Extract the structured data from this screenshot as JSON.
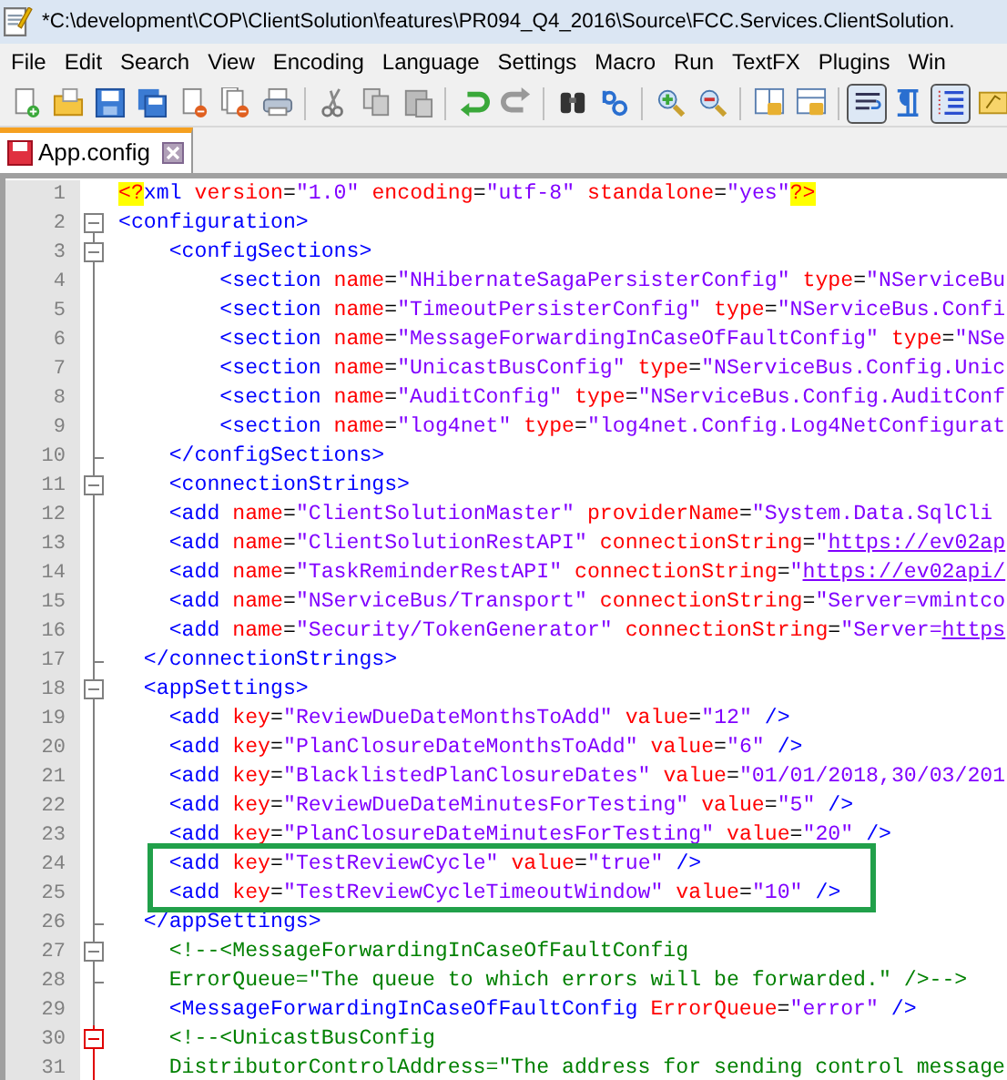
{
  "window": {
    "title": "*C:\\development\\COP\\ClientSolution\\features\\PR094_Q4_2016\\Source\\FCC.Services.ClientSolution."
  },
  "menu": [
    "File",
    "Edit",
    "Search",
    "View",
    "Encoding",
    "Language",
    "Settings",
    "Macro",
    "Run",
    "TextFX",
    "Plugins",
    "Win"
  ],
  "toolbar": [
    {
      "kind": "new",
      "pressed": false
    },
    {
      "kind": "open",
      "pressed": false
    },
    {
      "kind": "save",
      "pressed": false
    },
    {
      "kind": "save-all",
      "pressed": false
    },
    {
      "kind": "close",
      "pressed": false
    },
    {
      "kind": "close-all",
      "pressed": false
    },
    {
      "kind": "print",
      "pressed": false
    },
    {
      "kind": "sep"
    },
    {
      "kind": "cut",
      "pressed": false
    },
    {
      "kind": "copy",
      "pressed": false
    },
    {
      "kind": "paste",
      "pressed": false
    },
    {
      "kind": "sep"
    },
    {
      "kind": "undo",
      "pressed": false
    },
    {
      "kind": "redo",
      "pressed": false
    },
    {
      "kind": "sep"
    },
    {
      "kind": "find",
      "pressed": false
    },
    {
      "kind": "replace",
      "pressed": false
    },
    {
      "kind": "sep"
    },
    {
      "kind": "zoom-in",
      "pressed": false
    },
    {
      "kind": "zoom-out",
      "pressed": false
    },
    {
      "kind": "sep"
    },
    {
      "kind": "sync-v",
      "pressed": false
    },
    {
      "kind": "sync-h",
      "pressed": false
    },
    {
      "kind": "sep"
    },
    {
      "kind": "wrap",
      "pressed": true
    },
    {
      "kind": "all-chars",
      "pressed": false
    },
    {
      "kind": "indent-guide",
      "pressed": true
    },
    {
      "kind": "macro",
      "pressed": false
    }
  ],
  "tabs": [
    {
      "label": "App.config",
      "selected": true,
      "modified": true
    }
  ],
  "editor": {
    "lines": [
      {
        "number": "1",
        "collapsible": false,
        "block_end": false,
        "boxed": false,
        "tokens": [
          {
            "kind": "pi",
            "text": "<?"
          },
          {
            "kind": "tag",
            "text": "xml"
          },
          {
            "kind": "attr",
            "text": " version"
          },
          {
            "kind": "plain",
            "text": "="
          },
          {
            "kind": "value",
            "text": "\"1.0\""
          },
          {
            "kind": "attr",
            "text": " encoding"
          },
          {
            "kind": "plain",
            "text": "="
          },
          {
            "kind": "value",
            "text": "\"utf-8\""
          },
          {
            "kind": "attr",
            "text": " standalone"
          },
          {
            "kind": "plain",
            "text": "="
          },
          {
            "kind": "value",
            "text": "\"yes\""
          },
          {
            "kind": "pi",
            "text": "?>"
          }
        ]
      },
      {
        "number": "2",
        "collapsible": true,
        "block_end": false,
        "highlighted": false,
        "boxed": false,
        "tokens": [
          {
            "kind": "tag",
            "text": "<configuration>"
          }
        ]
      },
      {
        "number": "3",
        "collapsible": true,
        "block_end": false,
        "highlighted": false,
        "boxed": false,
        "tokens": [
          {
            "kind": "tag",
            "text": "    <configSections>"
          }
        ]
      },
      {
        "number": "4",
        "collapsible": false,
        "block_end": false,
        "highlighted": false,
        "boxed": false,
        "tokens": [
          {
            "kind": "tag",
            "text": "        <section"
          },
          {
            "kind": "attr",
            "text": " name"
          },
          {
            "kind": "plain",
            "text": "="
          },
          {
            "kind": "value",
            "text": "\"NHibernateSagaPersisterConfig\""
          },
          {
            "kind": "attr",
            "text": " type"
          },
          {
            "kind": "plain",
            "text": "="
          },
          {
            "kind": "value",
            "text": "\"NServiceBu"
          }
        ]
      },
      {
        "number": "5",
        "collapsible": false,
        "block_end": false,
        "highlighted": false,
        "boxed": false,
        "tokens": [
          {
            "kind": "tag",
            "text": "        <section"
          },
          {
            "kind": "attr",
            "text": " name"
          },
          {
            "kind": "plain",
            "text": "="
          },
          {
            "kind": "value",
            "text": "\"TimeoutPersisterConfig\""
          },
          {
            "kind": "attr",
            "text": " type"
          },
          {
            "kind": "plain",
            "text": "="
          },
          {
            "kind": "value",
            "text": "\"NServiceBus.Confi"
          }
        ]
      },
      {
        "number": "6",
        "collapsible": false,
        "block_end": false,
        "highlighted": false,
        "boxed": false,
        "tokens": [
          {
            "kind": "tag",
            "text": "        <section"
          },
          {
            "kind": "attr",
            "text": " name"
          },
          {
            "kind": "plain",
            "text": "="
          },
          {
            "kind": "value",
            "text": "\"MessageForwardingInCaseOfFaultConfig\""
          },
          {
            "kind": "attr",
            "text": " type"
          },
          {
            "kind": "plain",
            "text": "="
          },
          {
            "kind": "value",
            "text": "\"NSe"
          }
        ]
      },
      {
        "number": "7",
        "collapsible": false,
        "block_end": false,
        "highlighted": false,
        "boxed": false,
        "tokens": [
          {
            "kind": "tag",
            "text": "        <section"
          },
          {
            "kind": "attr",
            "text": " name"
          },
          {
            "kind": "plain",
            "text": "="
          },
          {
            "kind": "value",
            "text": "\"UnicastBusConfig\""
          },
          {
            "kind": "attr",
            "text": " type"
          },
          {
            "kind": "plain",
            "text": "="
          },
          {
            "kind": "value",
            "text": "\"NServiceBus.Config.Unic"
          }
        ]
      },
      {
        "number": "8",
        "collapsible": false,
        "block_end": false,
        "highlighted": false,
        "boxed": false,
        "tokens": [
          {
            "kind": "tag",
            "text": "        <section"
          },
          {
            "kind": "attr",
            "text": " name"
          },
          {
            "kind": "plain",
            "text": "="
          },
          {
            "kind": "value",
            "text": "\"AuditConfig\""
          },
          {
            "kind": "attr",
            "text": " type"
          },
          {
            "kind": "plain",
            "text": "="
          },
          {
            "kind": "value",
            "text": "\"NServiceBus.Config.AuditConf"
          }
        ]
      },
      {
        "number": "9",
        "collapsible": false,
        "block_end": false,
        "highlighted": false,
        "boxed": false,
        "tokens": [
          {
            "kind": "tag",
            "text": "        <section"
          },
          {
            "kind": "attr",
            "text": " name"
          },
          {
            "kind": "plain",
            "text": "="
          },
          {
            "kind": "value",
            "text": "\"log4net\""
          },
          {
            "kind": "attr",
            "text": " type"
          },
          {
            "kind": "plain",
            "text": "="
          },
          {
            "kind": "value",
            "text": "\"log4net.Config.Log4NetConfigurat"
          }
        ]
      },
      {
        "number": "10",
        "collapsible": false,
        "block_end": true,
        "highlighted": false,
        "boxed": false,
        "tokens": [
          {
            "kind": "tag",
            "text": "    </configSections>"
          }
        ]
      },
      {
        "number": "11",
        "collapsible": true,
        "block_end": false,
        "highlighted": false,
        "boxed": false,
        "tokens": [
          {
            "kind": "tag",
            "text": "    <connectionStrings>"
          }
        ]
      },
      {
        "number": "12",
        "collapsible": false,
        "block_end": false,
        "highlighted": false,
        "boxed": false,
        "tokens": [
          {
            "kind": "tag",
            "text": "    <add"
          },
          {
            "kind": "attr",
            "text": " name"
          },
          {
            "kind": "plain",
            "text": "="
          },
          {
            "kind": "value",
            "text": "\"ClientSolutionMaster\""
          },
          {
            "kind": "attr",
            "text": " providerName"
          },
          {
            "kind": "plain",
            "text": "="
          },
          {
            "kind": "value",
            "text": "\"System.Data.SqlCli"
          }
        ]
      },
      {
        "number": "13",
        "collapsible": false,
        "block_end": false,
        "highlighted": false,
        "boxed": false,
        "tokens": [
          {
            "kind": "tag",
            "text": "    <add"
          },
          {
            "kind": "attr",
            "text": " name"
          },
          {
            "kind": "plain",
            "text": "="
          },
          {
            "kind": "value",
            "text": "\"ClientSolutionRestAPI\""
          },
          {
            "kind": "attr",
            "text": " connectionString"
          },
          {
            "kind": "plain",
            "text": "="
          },
          {
            "kind": "value",
            "text": "\""
          },
          {
            "kind": "link",
            "text": "https://ev02ap"
          }
        ]
      },
      {
        "number": "14",
        "collapsible": false,
        "block_end": false,
        "highlighted": false,
        "boxed": false,
        "tokens": [
          {
            "kind": "tag",
            "text": "    <add"
          },
          {
            "kind": "attr",
            "text": " name"
          },
          {
            "kind": "plain",
            "text": "="
          },
          {
            "kind": "value",
            "text": "\"TaskReminderRestAPI\""
          },
          {
            "kind": "attr",
            "text": " connectionString"
          },
          {
            "kind": "plain",
            "text": "="
          },
          {
            "kind": "value",
            "text": "\""
          },
          {
            "kind": "link",
            "text": "https://ev02api/"
          }
        ]
      },
      {
        "number": "15",
        "collapsible": false,
        "block_end": false,
        "highlighted": false,
        "boxed": false,
        "tokens": [
          {
            "kind": "tag",
            "text": "    <add"
          },
          {
            "kind": "attr",
            "text": " name"
          },
          {
            "kind": "plain",
            "text": "="
          },
          {
            "kind": "value",
            "text": "\"NServiceBus/Transport\""
          },
          {
            "kind": "attr",
            "text": " connectionString"
          },
          {
            "kind": "plain",
            "text": "="
          },
          {
            "kind": "value",
            "text": "\"Server=vmintco"
          }
        ]
      },
      {
        "number": "16",
        "collapsible": false,
        "block_end": false,
        "highlighted": false,
        "boxed": false,
        "tokens": [
          {
            "kind": "tag",
            "text": "    <add"
          },
          {
            "kind": "attr",
            "text": " name"
          },
          {
            "kind": "plain",
            "text": "="
          },
          {
            "kind": "value",
            "text": "\"Security/TokenGenerator\""
          },
          {
            "kind": "attr",
            "text": " connectionString"
          },
          {
            "kind": "plain",
            "text": "="
          },
          {
            "kind": "value",
            "text": "\"Server="
          },
          {
            "kind": "link",
            "text": "https"
          }
        ]
      },
      {
        "number": "17",
        "collapsible": false,
        "block_end": true,
        "highlighted": false,
        "boxed": false,
        "tokens": [
          {
            "kind": "tag",
            "text": "  </connectionStrings>"
          }
        ]
      },
      {
        "number": "18",
        "collapsible": true,
        "block_end": false,
        "highlighted": false,
        "boxed": false,
        "tokens": [
          {
            "kind": "tag",
            "text": "  <appSettings>"
          }
        ]
      },
      {
        "number": "19",
        "collapsible": false,
        "block_end": false,
        "highlighted": false,
        "boxed": false,
        "tokens": [
          {
            "kind": "tag",
            "text": "    <add"
          },
          {
            "kind": "attr",
            "text": " key"
          },
          {
            "kind": "plain",
            "text": "="
          },
          {
            "kind": "value",
            "text": "\"ReviewDueDateMonthsToAdd\""
          },
          {
            "kind": "attr",
            "text": " value"
          },
          {
            "kind": "plain",
            "text": "="
          },
          {
            "kind": "value",
            "text": "\"12\""
          },
          {
            "kind": "tag",
            "text": " />"
          }
        ]
      },
      {
        "number": "20",
        "collapsible": false,
        "block_end": false,
        "highlighted": false,
        "boxed": false,
        "tokens": [
          {
            "kind": "tag",
            "text": "    <add"
          },
          {
            "kind": "attr",
            "text": " key"
          },
          {
            "kind": "plain",
            "text": "="
          },
          {
            "kind": "value",
            "text": "\"PlanClosureDateMonthsToAdd\""
          },
          {
            "kind": "attr",
            "text": " value"
          },
          {
            "kind": "plain",
            "text": "="
          },
          {
            "kind": "value",
            "text": "\"6\""
          },
          {
            "kind": "tag",
            "text": " />"
          }
        ]
      },
      {
        "number": "21",
        "collapsible": false,
        "block_end": false,
        "highlighted": false,
        "boxed": false,
        "tokens": [
          {
            "kind": "tag",
            "text": "    <add"
          },
          {
            "kind": "attr",
            "text": " key"
          },
          {
            "kind": "plain",
            "text": "="
          },
          {
            "kind": "value",
            "text": "\"BlacklistedPlanClosureDates\""
          },
          {
            "kind": "attr",
            "text": " value"
          },
          {
            "kind": "plain",
            "text": "="
          },
          {
            "kind": "value",
            "text": "\"01/01/2018,30/03/201"
          }
        ]
      },
      {
        "number": "22",
        "collapsible": false,
        "block_end": false,
        "highlighted": false,
        "boxed": false,
        "tokens": [
          {
            "kind": "tag",
            "text": "    <add"
          },
          {
            "kind": "attr",
            "text": " key"
          },
          {
            "kind": "plain",
            "text": "="
          },
          {
            "kind": "value",
            "text": "\"ReviewDueDateMinutesForTesting\""
          },
          {
            "kind": "attr",
            "text": " value"
          },
          {
            "kind": "plain",
            "text": "="
          },
          {
            "kind": "value",
            "text": "\"5\""
          },
          {
            "kind": "tag",
            "text": " />"
          }
        ]
      },
      {
        "number": "23",
        "collapsible": false,
        "block_end": false,
        "highlighted": false,
        "boxed": false,
        "tokens": [
          {
            "kind": "tag",
            "text": "    <add"
          },
          {
            "kind": "attr",
            "text": " key"
          },
          {
            "kind": "plain",
            "text": "="
          },
          {
            "kind": "value",
            "text": "\"PlanClosureDateMinutesForTesting\""
          },
          {
            "kind": "attr",
            "text": " value"
          },
          {
            "kind": "plain",
            "text": "="
          },
          {
            "kind": "value",
            "text": "\"20\""
          },
          {
            "kind": "tag",
            "text": " />"
          }
        ]
      },
      {
        "number": "24",
        "collapsible": false,
        "block_end": false,
        "highlighted": false,
        "boxed": true,
        "tokens": [
          {
            "kind": "tag",
            "text": "    <add"
          },
          {
            "kind": "attr",
            "text": " key"
          },
          {
            "kind": "plain",
            "text": "="
          },
          {
            "kind": "value",
            "text": "\"TestReviewCycle\""
          },
          {
            "kind": "attr",
            "text": " value"
          },
          {
            "kind": "plain",
            "text": "="
          },
          {
            "kind": "value",
            "text": "\"true\""
          },
          {
            "kind": "tag",
            "text": " />"
          }
        ]
      },
      {
        "number": "25",
        "collapsible": false,
        "block_end": false,
        "highlighted": false,
        "boxed": true,
        "tokens": [
          {
            "kind": "tag",
            "text": "    <add"
          },
          {
            "kind": "attr",
            "text": " key"
          },
          {
            "kind": "plain",
            "text": "="
          },
          {
            "kind": "value",
            "text": "\"TestReviewCycleTimeoutWindow\""
          },
          {
            "kind": "attr",
            "text": " value"
          },
          {
            "kind": "plain",
            "text": "="
          },
          {
            "kind": "value",
            "text": "\"10\""
          },
          {
            "kind": "tag",
            "text": " />"
          }
        ]
      },
      {
        "number": "26",
        "collapsible": false,
        "block_end": true,
        "highlighted": false,
        "boxed": false,
        "tokens": [
          {
            "kind": "tag",
            "text": "  </appSettings>"
          }
        ]
      },
      {
        "number": "27",
        "collapsible": true,
        "block_end": false,
        "highlighted": false,
        "boxed": false,
        "tokens": [
          {
            "kind": "comment",
            "text": "    <!--<MessageForwardingInCaseOfFaultConfig"
          }
        ]
      },
      {
        "number": "28",
        "collapsible": false,
        "block_end": true,
        "highlighted": false,
        "boxed": false,
        "tokens": [
          {
            "kind": "comment",
            "text": "    ErrorQueue=\"The queue to which errors will be forwarded.\" />-->"
          }
        ]
      },
      {
        "number": "29",
        "collapsible": false,
        "block_end": false,
        "highlighted": false,
        "boxed": false,
        "tokens": [
          {
            "kind": "tag",
            "text": "    <MessageForwardingInCaseOfFaultConfig"
          },
          {
            "kind": "attr",
            "text": " ErrorQueue"
          },
          {
            "kind": "plain",
            "text": "="
          },
          {
            "kind": "value",
            "text": "\"error\""
          },
          {
            "kind": "tag",
            "text": " />"
          }
        ]
      },
      {
        "number": "30",
        "collapsible": true,
        "block_end": false,
        "highlighted": true,
        "boxed": false,
        "tokens": [
          {
            "kind": "comment",
            "text": "    <!--<UnicastBusConfig"
          }
        ]
      },
      {
        "number": "31",
        "collapsible": false,
        "block_end": false,
        "highlighted": true,
        "boxed": false,
        "tokens": [
          {
            "kind": "comment",
            "text": "    DistributorControlAddress=\"The address for sending control message"
          }
        ]
      }
    ]
  }
}
